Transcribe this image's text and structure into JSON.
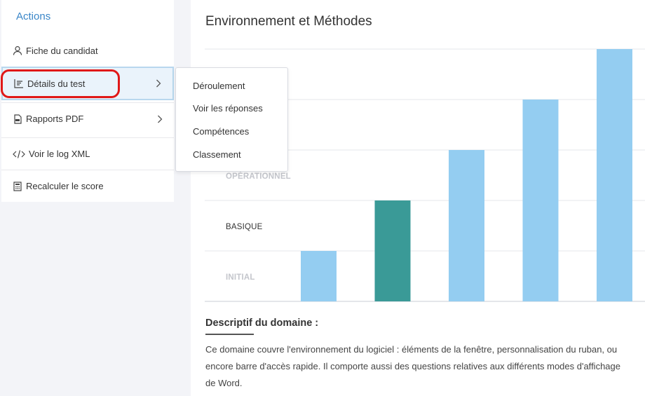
{
  "sidebar": {
    "title": "Actions",
    "items": [
      {
        "label": "Fiche du candidat",
        "icon": "user-icon"
      },
      {
        "label": "Détails du test",
        "icon": "chart-icon"
      },
      {
        "label": "Rapports PDF",
        "icon": "pdf-file-icon"
      },
      {
        "label": "Voir le log XML",
        "icon": "code-icon"
      },
      {
        "label": "Recalculer le score",
        "icon": "calculator-icon"
      }
    ]
  },
  "submenu": {
    "items": [
      "Déroulement",
      "Voir les réponses",
      "Compétences",
      "Classement"
    ]
  },
  "main": {
    "title": "Environnement et Méthodes",
    "desc_title": "Descriptif du domaine :",
    "desc_lines": [
      "Ce domaine couvre l'environnement du logiciel : éléments de la fenêtre, personnalisation du ruban, ou",
      "encore barre d'accès rapide. Il comporte aussi des questions relatives aux différents modes d'affichage",
      "de Word."
    ]
  },
  "chart_data": {
    "type": "bar",
    "levels": [
      "INITIAL",
      "BASIQUE",
      "OPÉRATIONNEL"
    ],
    "highlighted_level": "BASIQUE",
    "values": [
      1,
      2,
      3,
      4,
      5
    ],
    "highlighted_index": 1,
    "ylim": [
      0,
      5
    ],
    "colors": {
      "bar": "#94cdf1",
      "highlight": "#3a9a97"
    }
  },
  "colors": {
    "accent": "#3a86c8",
    "annotation": "#e01818"
  }
}
